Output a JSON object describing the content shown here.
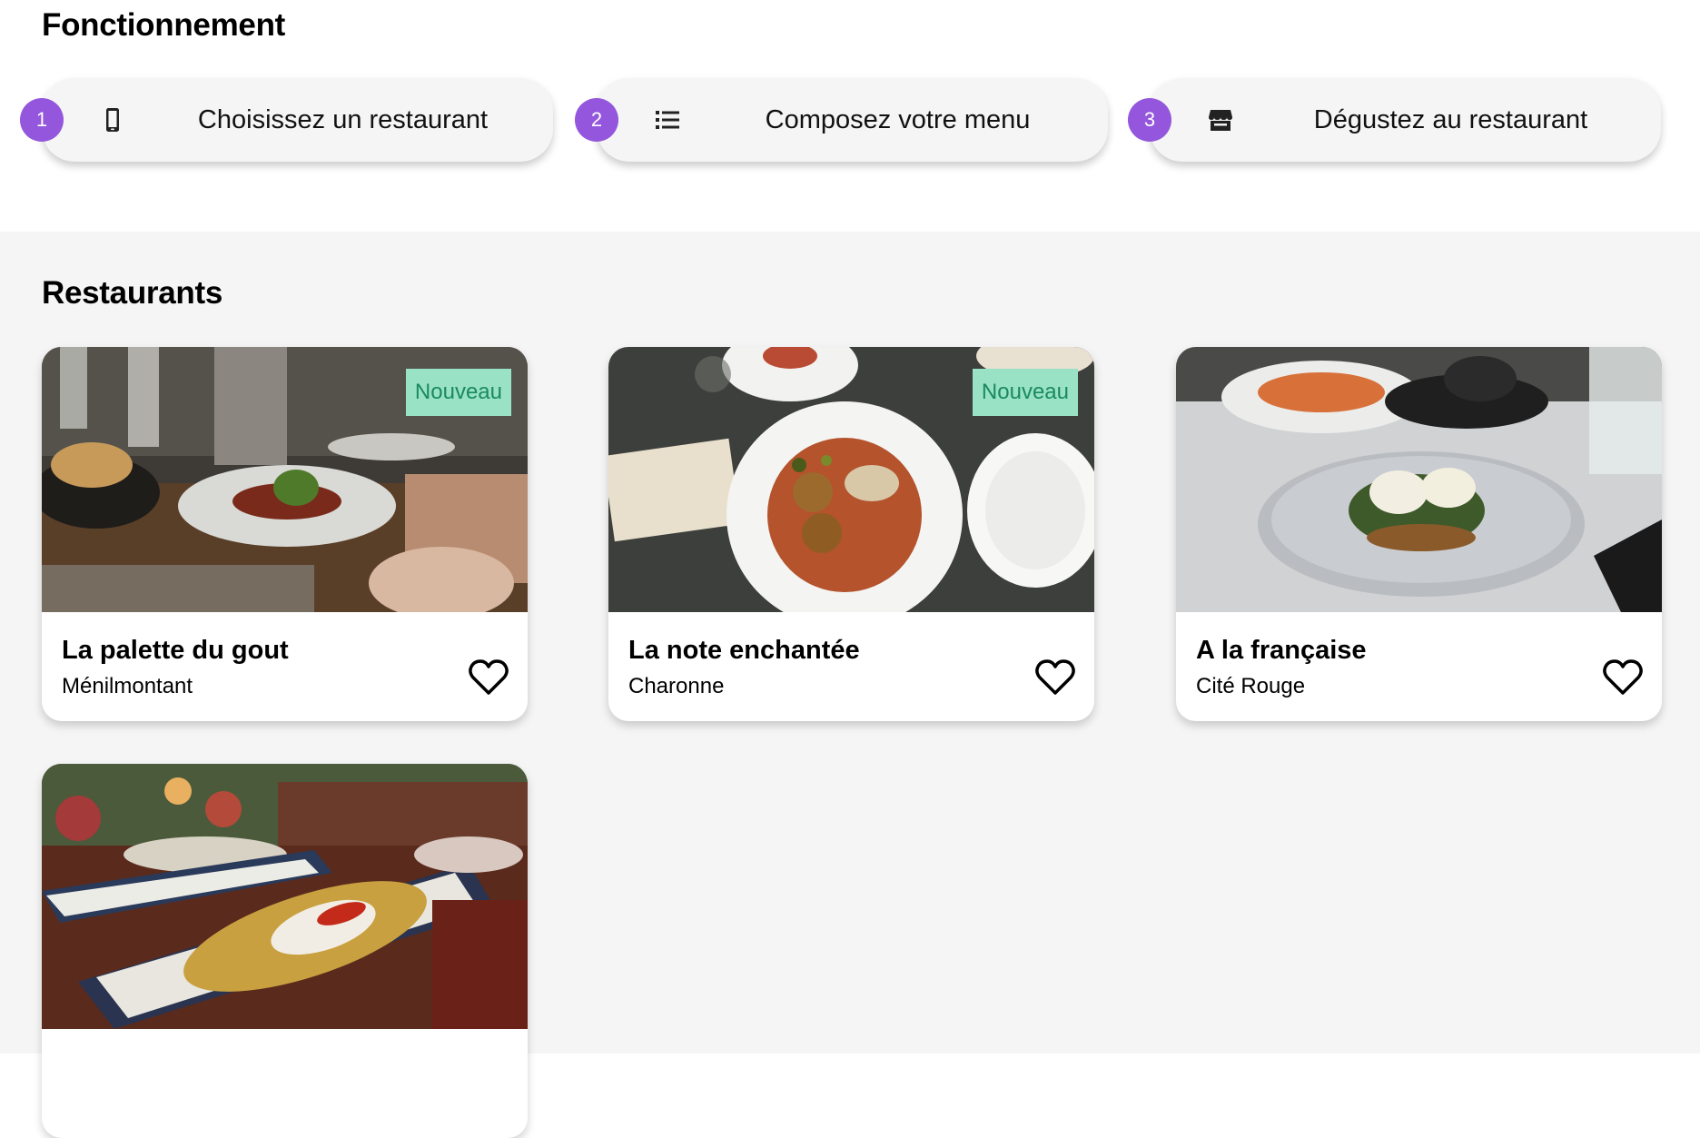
{
  "how_it_works": {
    "title": "Fonctionnement",
    "steps": [
      {
        "number": "1",
        "icon": "smartphone-icon",
        "label": "Choisissez un restaurant"
      },
      {
        "number": "2",
        "icon": "list-icon",
        "label": "Composez votre menu"
      },
      {
        "number": "3",
        "icon": "store-icon",
        "label": "Dégustez au restaurant"
      }
    ]
  },
  "restaurants": {
    "title": "Restaurants",
    "items": [
      {
        "name": "La palette du gout",
        "district": "Ménilmontant",
        "badge": "Nouveau"
      },
      {
        "name": "La note enchantée",
        "district": "Charonne",
        "badge": "Nouveau"
      },
      {
        "name": "A la française",
        "district": "Cité Rouge"
      },
      {
        "name": "",
        "district": ""
      }
    ]
  },
  "colors": {
    "accent": "#9356dc",
    "badge_bg": "#99e2c6",
    "badge_text": "#1a8a5d",
    "section_bg": "#f5f5f5"
  }
}
